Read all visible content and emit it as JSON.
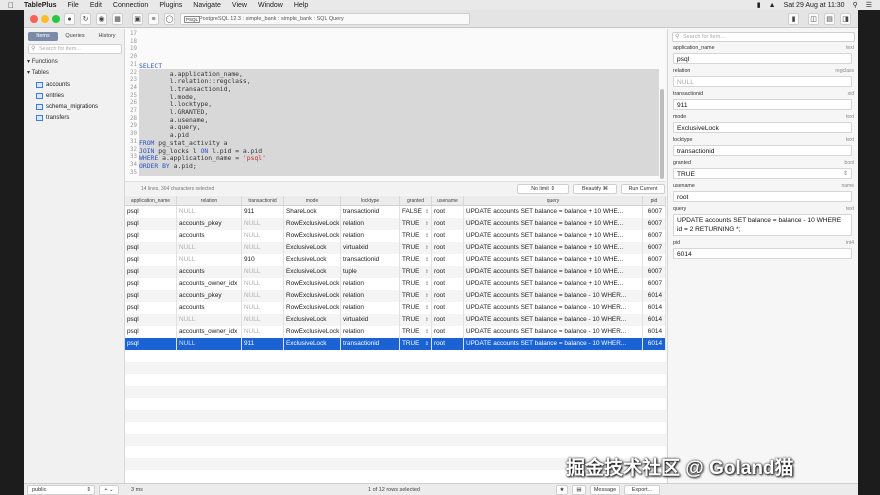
{
  "menubar": {
    "app": "TablePlus",
    "items": [
      "File",
      "Edit",
      "Connection",
      "Plugins",
      "Navigate",
      "View",
      "Window",
      "Help"
    ],
    "datetime": "Sat 29 Aug at 11:30"
  },
  "toolbar": {
    "conn_tag": "PSQL",
    "connection": "PostgreSQL 12.3 : simple_bank : simple_bank : SQL Query"
  },
  "sidebar": {
    "tabs": [
      "Items",
      "Queries",
      "History"
    ],
    "search_placeholder": "Search for item...",
    "functions_label": "Functions",
    "tables_label": "Tables",
    "tables": [
      "accounts",
      "entries",
      "schema_migrations",
      "transfers"
    ],
    "schema": "public"
  },
  "editor": {
    "lines": [
      {
        "n": "17",
        "code": ""
      },
      {
        "n": "18",
        "code": ""
      },
      {
        "n": "19",
        "code": ""
      },
      {
        "n": "20",
        "code": ""
      },
      {
        "n": "21",
        "code": "SELECT"
      },
      {
        "n": "22",
        "code": "        a.application_name,"
      },
      {
        "n": "23",
        "code": "        l.relation::regclass,"
      },
      {
        "n": "24",
        "code": "        l.transactionid,"
      },
      {
        "n": "25",
        "code": "        l.mode,"
      },
      {
        "n": "26",
        "code": "        l.locktype,"
      },
      {
        "n": "27",
        "code": "        l.GRANTED,"
      },
      {
        "n": "28",
        "code": "        a.usename,"
      },
      {
        "n": "29",
        "code": "        a.query,"
      },
      {
        "n": "30",
        "code": "        a.pid"
      },
      {
        "n": "31",
        "code": "FROM pg_stat_activity a"
      },
      {
        "n": "32",
        "code": "JOIN pg_locks l ON l.pid = a.pid"
      },
      {
        "n": "33",
        "code": "WHERE a.application_name = 'psql'"
      },
      {
        "n": "34",
        "code": "ORDER BY a.pid;"
      },
      {
        "n": "35",
        "code": ""
      }
    ],
    "status": "14 lines, 304 characters selected",
    "limit": "No limit",
    "beautify": "Beautify ⌘",
    "run": "Run Current"
  },
  "grid": {
    "columns": [
      "application_name",
      "relation",
      "transactionid",
      "mode",
      "locktype",
      "granted",
      "usename",
      "query",
      "pid"
    ],
    "rows": [
      [
        "psql",
        "NULL",
        "911",
        "ShareLock",
        "transactionid",
        "FALSE",
        "root",
        "UPDATE accounts SET balance = balance + 10 WHE...",
        "6007"
      ],
      [
        "psql",
        "accounts_pkey",
        "NULL",
        "RowExclusiveLock",
        "relation",
        "TRUE",
        "root",
        "UPDATE accounts SET balance = balance + 10 WHE...",
        "6007"
      ],
      [
        "psql",
        "accounts",
        "NULL",
        "RowExclusiveLock",
        "relation",
        "TRUE",
        "root",
        "UPDATE accounts SET balance = balance + 10 WHE...",
        "6007"
      ],
      [
        "psql",
        "NULL",
        "NULL",
        "ExclusiveLock",
        "virtualxid",
        "TRUE",
        "root",
        "UPDATE accounts SET balance = balance + 10 WHE...",
        "6007"
      ],
      [
        "psql",
        "NULL",
        "910",
        "ExclusiveLock",
        "transactionid",
        "TRUE",
        "root",
        "UPDATE accounts SET balance = balance + 10 WHE...",
        "6007"
      ],
      [
        "psql",
        "accounts",
        "NULL",
        "ExclusiveLock",
        "tuple",
        "TRUE",
        "root",
        "UPDATE accounts SET balance = balance + 10 WHE...",
        "6007"
      ],
      [
        "psql",
        "accounts_owner_idx",
        "NULL",
        "RowExclusiveLock",
        "relation",
        "TRUE",
        "root",
        "UPDATE accounts SET balance = balance + 10 WHE...",
        "6007"
      ],
      [
        "psql",
        "accounts_pkey",
        "NULL",
        "RowExclusiveLock",
        "relation",
        "TRUE",
        "root",
        "UPDATE accounts SET balance = balance - 10 WHER...",
        "6014"
      ],
      [
        "psql",
        "accounts",
        "NULL",
        "RowExclusiveLock",
        "relation",
        "TRUE",
        "root",
        "UPDATE accounts SET balance = balance - 10 WHER...",
        "6014"
      ],
      [
        "psql",
        "NULL",
        "NULL",
        "ExclusiveLock",
        "virtualxid",
        "TRUE",
        "root",
        "UPDATE accounts SET balance = balance - 10 WHER...",
        "6014"
      ],
      [
        "psql",
        "accounts_owner_idx",
        "NULL",
        "RowExclusiveLock",
        "relation",
        "TRUE",
        "root",
        "UPDATE accounts SET balance = balance - 10 WHER...",
        "6014"
      ],
      [
        "psql",
        "NULL",
        "911",
        "ExclusiveLock",
        "transactionid",
        "TRUE",
        "root",
        "UPDATE accounts SET balance = balance - 10 WHER...",
        "6014"
      ]
    ],
    "selected_row": 11
  },
  "detail": {
    "search_placeholder": "Search for item...",
    "fields": [
      {
        "label": "application_name",
        "type": "text",
        "value": "psql"
      },
      {
        "label": "relation",
        "type": "regclass",
        "value": "NULL"
      },
      {
        "label": "transactionid",
        "type": "xid",
        "value": "911"
      },
      {
        "label": "mode",
        "type": "text",
        "value": "ExclusiveLock"
      },
      {
        "label": "locktype",
        "type": "text",
        "value": "transactionid"
      },
      {
        "label": "granted",
        "type": "bool",
        "value": "TRUE"
      },
      {
        "label": "usename",
        "type": "name",
        "value": "root"
      },
      {
        "label": "query",
        "type": "text",
        "value": "UPDATE accounts SET balance = balance - 10 WHERE id = 2 RETURNING *;"
      },
      {
        "label": "pid",
        "type": "int4",
        "value": "6014"
      }
    ]
  },
  "statusbar": {
    "timing": "3 ms",
    "rows": "1 of 12 rows selected",
    "message": "Message",
    "export": "Export..."
  },
  "watermark": "掘金技术社区 @ Goland猫"
}
